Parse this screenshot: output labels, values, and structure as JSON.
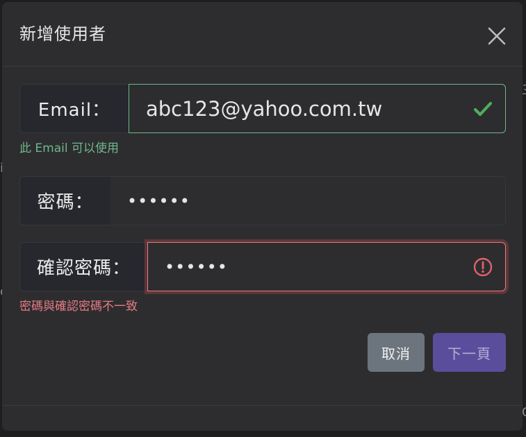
{
  "modal": {
    "title": "新增使用者"
  },
  "form": {
    "email": {
      "label": "Email：",
      "value": "abc123@yahoo.com.tw",
      "status": "valid",
      "help": "此 Email 可以使用"
    },
    "password": {
      "label": "密碼：",
      "value": "••••••"
    },
    "confirm_password": {
      "label": "確認密碼：",
      "value": "••••••",
      "status": "invalid",
      "help": "密碼與確認密碼不一致"
    }
  },
  "buttons": {
    "cancel_label": "取消",
    "next_label": "下一頁"
  },
  "icons": {
    "close": "close-icon",
    "valid": "check-icon",
    "invalid": "exclamation-circle-icon"
  },
  "colors": {
    "valid": "#6fb78c",
    "invalid": "#e67c84",
    "primary": "#5a4e9c",
    "secondary": "#6c757d",
    "modal_bg": "#2d2d2f"
  }
}
